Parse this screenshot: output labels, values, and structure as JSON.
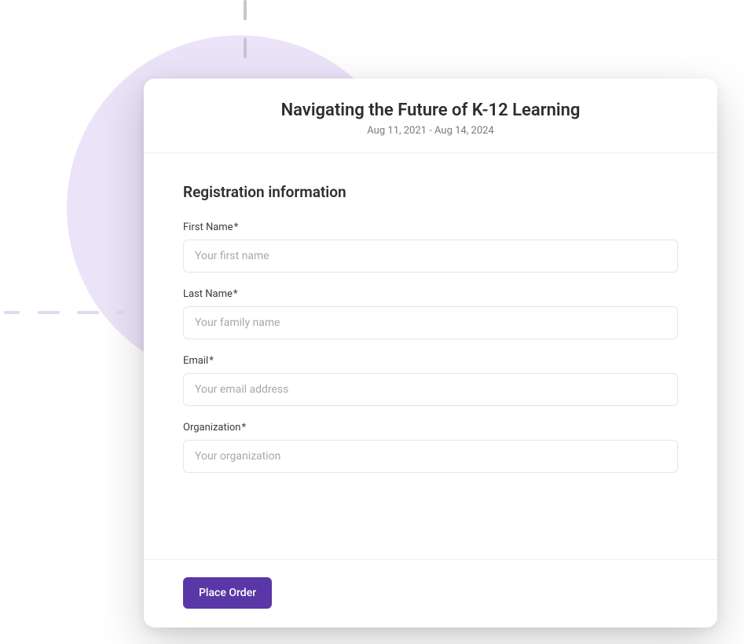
{
  "header": {
    "title": "Navigating the Future of K-12 Learning",
    "date_range": "Aug 11, 2021 - Aug 14, 2024"
  },
  "section": {
    "title": "Registration information"
  },
  "fields": {
    "first_name": {
      "label": "First Name",
      "required_mark": "*",
      "placeholder": "Your first name",
      "value": ""
    },
    "last_name": {
      "label": "Last Name",
      "required_mark": "*",
      "placeholder": "Your family name",
      "value": ""
    },
    "email": {
      "label": "Email",
      "required_mark": "*",
      "placeholder": "Your email address",
      "value": ""
    },
    "organization": {
      "label": "Organization",
      "required_mark": "*",
      "placeholder": "Your organization",
      "value": ""
    }
  },
  "actions": {
    "submit_label": "Place Order"
  }
}
